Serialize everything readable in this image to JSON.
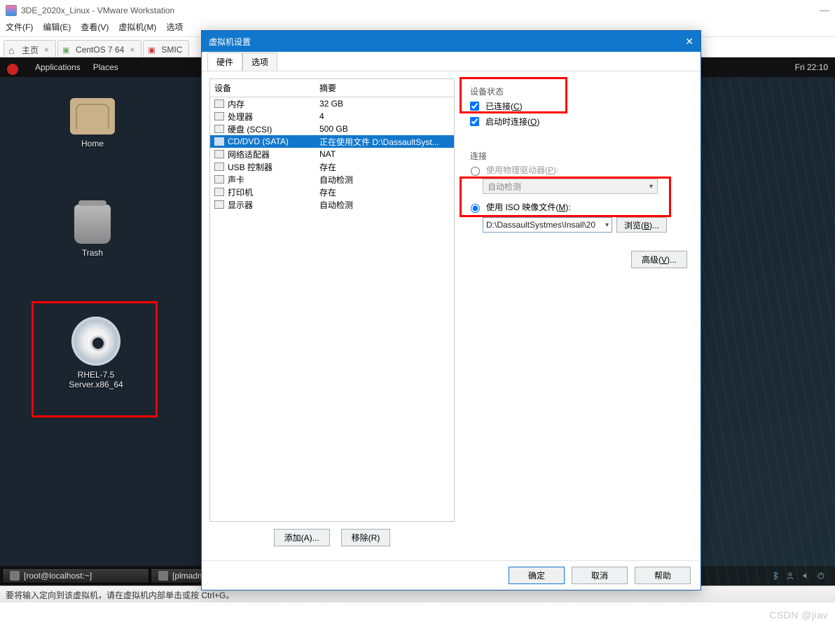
{
  "window": {
    "title": "3DE_2020x_Linux - VMware Workstation",
    "minimize": "—"
  },
  "menu": {
    "file": "文件(F)",
    "edit": "编辑(E)",
    "view": "查看(V)",
    "vm": "虚拟机(M)",
    "opts": "选项"
  },
  "tabs": {
    "home": "主页",
    "cent": "CentOS 7 64",
    "smic": "SMIC"
  },
  "topbar": {
    "apps": "Applications",
    "places": "Places",
    "clock": "Fri 22:10"
  },
  "desktop": {
    "home": "Home",
    "trash": "Trash",
    "cd": "RHEL-7.5 Server.x86_64"
  },
  "taskbar": {
    "term1": "[root@localhost:~]",
    "term2": "[plmadm@localhost:/mnt/iso]"
  },
  "status": "要将输入定向到该虚拟机，请在虚拟机内部单击或按 Ctrl+G。",
  "watermark": "CSDN @jiav",
  "dialog": {
    "title": "虚拟机设置",
    "tab_hw": "硬件",
    "tab_opt": "选项",
    "col_dev": "设备",
    "col_sum": "摘要",
    "devices": [
      {
        "name": "内存",
        "summary": "32 GB"
      },
      {
        "name": "处理器",
        "summary": "4"
      },
      {
        "name": "硬盘 (SCSI)",
        "summary": "500 GB"
      },
      {
        "name": "CD/DVD (SATA)",
        "summary": "正在使用文件 D:\\DassaultSyst..."
      },
      {
        "name": "网络适配器",
        "summary": "NAT"
      },
      {
        "name": "USB 控制器",
        "summary": "存在"
      },
      {
        "name": "声卡",
        "summary": "自动检测"
      },
      {
        "name": "打印机",
        "summary": "存在"
      },
      {
        "name": "显示器",
        "summary": "自动检测"
      }
    ],
    "btn_add": "添加(A)...",
    "btn_remove": "移除(R)",
    "grp_state": "设备状态",
    "chk_connected_html": "已连接(<u>C</u>)",
    "chk_connect_on_html": "启动时连接(<u>O</u>)",
    "grp_conn": "连接",
    "rad_physical_html": "使用物理驱动器(<u>P</u>):",
    "combo_auto": "自动检测",
    "rad_iso_html": "使用 ISO 映像文件(<u>M</u>):",
    "iso_path": "D:\\DassaultSystmes\\Insall\\20",
    "btn_browse_html": "浏览(<u>B</u>)...",
    "btn_adv_html": "高级(<u>V</u>)...",
    "btn_ok": "确定",
    "btn_cancel": "取消",
    "btn_help": "帮助"
  }
}
